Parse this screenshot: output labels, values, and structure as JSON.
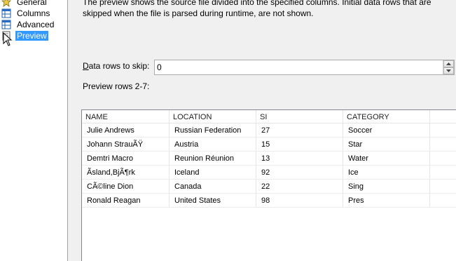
{
  "nav": {
    "items": [
      {
        "label": "General",
        "icon": "general-icon"
      },
      {
        "label": "Columns",
        "icon": "columns-icon"
      },
      {
        "label": "Advanced",
        "icon": "advanced-icon"
      },
      {
        "label": "Preview",
        "icon": "preview-icon",
        "selected": true
      }
    ]
  },
  "content": {
    "description": "The preview shows the source file divided into the specified columns. Initial data rows that are skipped when the file is parsed during runtime, are not shown.",
    "skip_label_u": "D",
    "skip_label_rest": "ata rows to skip:",
    "skip_value": "0",
    "preview_label": "Preview rows 2-7:"
  },
  "grid": {
    "headers": [
      "NAME",
      "LOCATION",
      "SI",
      "CATEGORY"
    ],
    "rows": [
      [
        "Julie Andrews",
        "Russian Federation",
        "27",
        "Soccer"
      ],
      [
        "Johann StrauÃŸ",
        "Austria",
        "15",
        "Star"
      ],
      [
        "Demtri Macro",
        "Reunion Réunion",
        "13",
        "Water"
      ],
      [
        "Ãsland,BjÃ¶rk",
        "Iceland",
        "92",
        "Ice"
      ],
      [
        "CÃ©line Dion",
        "Canada",
        "22",
        "Sing"
      ],
      [
        "Ronald Reagan",
        "United States",
        "98",
        "Pres"
      ]
    ]
  },
  "colors": {
    "selection": "#3399ff",
    "window_bg": "#f0f0f0",
    "grid_border": "#828790"
  }
}
